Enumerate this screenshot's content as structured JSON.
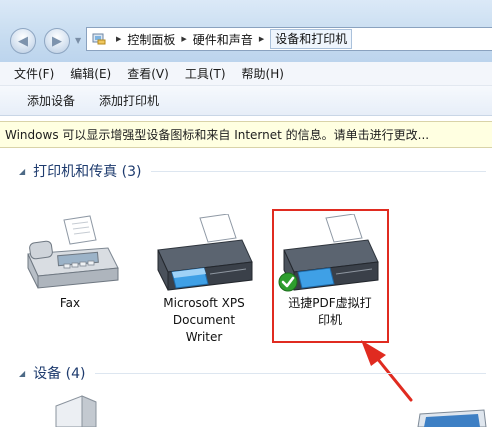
{
  "breadcrumb": {
    "items": [
      "控制面板",
      "硬件和声音",
      "设备和打印机"
    ]
  },
  "menu": {
    "items": [
      "文件(F)",
      "编辑(E)",
      "查看(V)",
      "工具(T)",
      "帮助(H)"
    ]
  },
  "commands": {
    "add_device": "添加设备",
    "add_printer": "添加打印机"
  },
  "info_bar": {
    "text": "Windows 可以显示增强型设备图标和来自 Internet 的信息。请单击进行更改..."
  },
  "groups": {
    "printers": {
      "title": "打印机和传真 (3)",
      "devices": [
        {
          "line1": "Fax",
          "line2": "",
          "line3": ""
        },
        {
          "line1": "Microsoft XPS",
          "line2": "Document",
          "line3": "Writer"
        },
        {
          "line1": "迅捷PDF虚拟打",
          "line2": "印机",
          "line3": "",
          "default": true
        }
      ]
    },
    "devices": {
      "title": "设备 (4)"
    }
  },
  "colors": {
    "highlight": "#e02b20",
    "group_title": "#1e3b6e",
    "info_bg": "#ffffe1"
  }
}
